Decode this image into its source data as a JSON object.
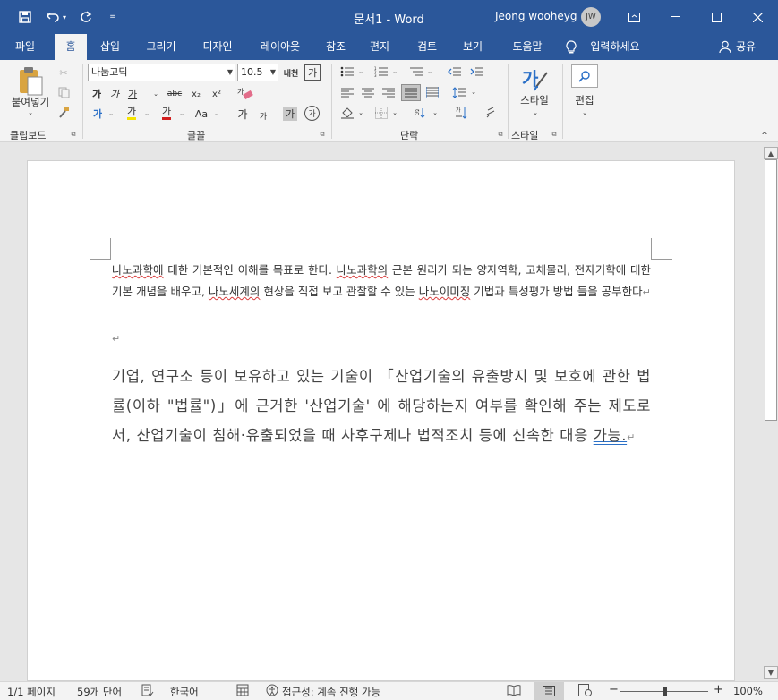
{
  "window": {
    "title": "문서1  -  Word",
    "user_name": "Jeong wooheyg",
    "user_initials": "JW"
  },
  "tabs": [
    {
      "label": "파일"
    },
    {
      "label": "홈"
    },
    {
      "label": "삽입"
    },
    {
      "label": "그리기"
    },
    {
      "label": "디자인"
    },
    {
      "label": "레이아웃"
    },
    {
      "label": "참조"
    },
    {
      "label": "편지"
    },
    {
      "label": "검토"
    },
    {
      "label": "보기"
    },
    {
      "label": "도움말"
    }
  ],
  "tell_me": "입력하세요",
  "share": "공유",
  "ribbon": {
    "clipboard": {
      "paste": "붙여넣기",
      "group": "클립보드"
    },
    "font": {
      "name": "나눔고딕",
      "size": "10.5",
      "group": "글꼴",
      "bold": "가",
      "italic": "가",
      "underline": "가",
      "strike": "abc",
      "sub": "x₂",
      "sup": "x²",
      "case": "Aa",
      "grow": "가",
      "shrink": "가",
      "shade": "가",
      "circle": "가",
      "highlight": "가",
      "color": "가",
      "effects": "가"
    },
    "paragraph": {
      "group": "단락"
    },
    "styles": {
      "label": "스타일",
      "group": "스타일"
    },
    "editing": {
      "label": "편집"
    }
  },
  "document": {
    "p1": [
      {
        "t": "나노과학에",
        "err": "spell"
      },
      {
        "t": " 대한 기본적인 이해를 목표로 한다. "
      },
      {
        "t": "나노과학의",
        "err": "spell"
      },
      {
        "t": " 근본 원리가 되는 양자역학, 고체물리, 전자기학에 대한 기본 개념을 배우고, "
      },
      {
        "t": "나노세계의",
        "err": "spell"
      },
      {
        "t": " 현상을 직접 보고 관찰할 수 있는 "
      },
      {
        "t": "나노이미징",
        "err": "spell"
      },
      {
        "t": " 기법과 특성평가 방법 들을 공부한다"
      }
    ],
    "p2_before": "기업, 연구소 등이 보유하고 있는 기술이 「산업기술의 유출방지 및 보호에 관한 법률(이하 \"법률\")」에 근거한 '산업기술' 에 해당하는지 여부를 확인해 주는 제도로서, 산업기술이 침해·유출되었을 때 사후구제나 법적조치 등에 신속한 대응 ",
    "p2_grammar": "가능.",
    "para_mark": "↵"
  },
  "status": {
    "page": "1/1 페이지",
    "words": "59개 단어",
    "language": "한국어",
    "accessibility": "접근성: 계속 진행 가능",
    "zoom": "100%"
  }
}
